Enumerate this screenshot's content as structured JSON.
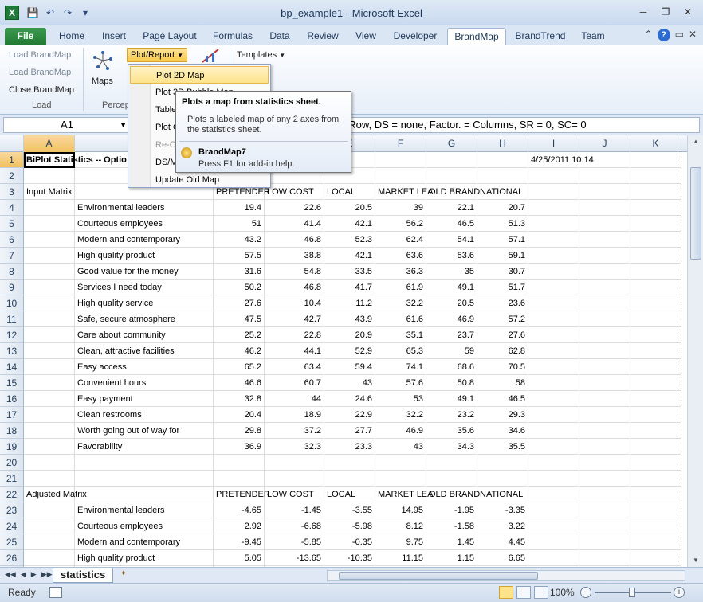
{
  "window": {
    "title": "bp_example1  -  Microsoft Excel",
    "app_icon": "X",
    "qat_icons": [
      "save-icon",
      "undo-icon",
      "redo-icon",
      "customize-qat-icon"
    ],
    "controls": [
      "minimize-icon",
      "restore-icon",
      "close-icon"
    ]
  },
  "ribbon_tabs": [
    {
      "label": "File"
    },
    {
      "label": "Home"
    },
    {
      "label": "Insert"
    },
    {
      "label": "Page Layout"
    },
    {
      "label": "Formulas"
    },
    {
      "label": "Data"
    },
    {
      "label": "Review"
    },
    {
      "label": "View"
    },
    {
      "label": "Developer"
    },
    {
      "label": "BrandMap"
    },
    {
      "label": "BrandTrend"
    },
    {
      "label": "Team"
    }
  ],
  "active_tab": "BrandMap",
  "ribbon": {
    "load_group": {
      "items": [
        "Load BrandMap",
        "Load BrandMap",
        "Close BrandMap"
      ],
      "label": "Load"
    },
    "maps_label": "Maps",
    "percep_label": "Percep",
    "plot_report_button": "Plot/Report",
    "templates_button": "Templates"
  },
  "plot_menu": {
    "items": [
      {
        "label": "Plot 2D Map",
        "state": "highlighted"
      },
      {
        "label": "Plot 3D Bubble Map",
        "state": "normal"
      },
      {
        "label": "Tables",
        "state": "normal"
      },
      {
        "label": "Plot Cluster",
        "state": "normal"
      },
      {
        "label": "Re-Color",
        "state": "disabled"
      },
      {
        "label": "DS/Mix",
        "state": "normal"
      },
      {
        "label": "Update Old Map",
        "state": "normal"
      }
    ]
  },
  "tooltip": {
    "title": "Plots a map from statistics sheet.",
    "description": "Plots a labeled map of any 2 axes from the statistics sheet.",
    "addin_name": "BrandMap7",
    "help": "Press F1 for add-in help."
  },
  "formula_bar": {
    "name_box": "A1",
    "content": "C = Row, DS = none, Factor. = Columns, SR = 0, SC= 0"
  },
  "columns": [
    "A",
    "B",
    "C",
    "D",
    "E",
    "F",
    "G",
    "H",
    "I",
    "J",
    "K"
  ],
  "selected_cell": "A1",
  "sheet": {
    "title_row": {
      "row": 1,
      "a": "BiPlot Statistics -- Optio",
      "d": "SC= 0",
      "i": "4/25/2011 10:14"
    },
    "input_label": "Input Matrix",
    "adjusted_label": "Adjusted Matrix",
    "headers": [
      "PRETENDER",
      "LOW COST",
      "LOCAL",
      "MARKET LEA",
      "OLD BRAND",
      "NATIONAL"
    ],
    "attributes": [
      "Environmental leaders",
      "Courteous employees",
      "Modern and contemporary",
      "High quality product",
      "Good value for the money",
      "Services I need today",
      "High quality service",
      "Safe, secure atmosphere",
      "Care about community",
      "Clean, attractive facilities",
      "Easy access",
      "Convenient hours",
      "Easy payment",
      "Clean restrooms",
      "Worth going out of way for",
      "Favorability"
    ],
    "input_values": [
      [
        "19.4",
        "22.6",
        "20.5",
        "39",
        "22.1",
        "20.7"
      ],
      [
        "51",
        "41.4",
        "42.1",
        "56.2",
        "46.5",
        "51.3"
      ],
      [
        "43.2",
        "46.8",
        "52.3",
        "62.4",
        "54.1",
        "57.1"
      ],
      [
        "57.5",
        "38.8",
        "42.1",
        "63.6",
        "53.6",
        "59.1"
      ],
      [
        "31.6",
        "54.8",
        "33.5",
        "36.3",
        "35",
        "30.7"
      ],
      [
        "50.2",
        "46.8",
        "41.7",
        "61.9",
        "49.1",
        "51.7"
      ],
      [
        "27.6",
        "10.4",
        "11.2",
        "32.2",
        "20.5",
        "23.6"
      ],
      [
        "47.5",
        "42.7",
        "43.9",
        "61.6",
        "46.9",
        "57.2"
      ],
      [
        "25.2",
        "22.8",
        "20.9",
        "35.1",
        "23.7",
        "27.6"
      ],
      [
        "46.2",
        "44.1",
        "52.9",
        "65.3",
        "59",
        "62.8"
      ],
      [
        "65.2",
        "63.4",
        "59.4",
        "74.1",
        "68.6",
        "70.5"
      ],
      [
        "46.6",
        "60.7",
        "43",
        "57.6",
        "50.8",
        "58"
      ],
      [
        "32.8",
        "44",
        "24.6",
        "53",
        "49.1",
        "46.5"
      ],
      [
        "20.4",
        "18.9",
        "22.9",
        "32.2",
        "23.2",
        "29.3"
      ],
      [
        "29.8",
        "37.2",
        "27.7",
        "46.9",
        "35.6",
        "34.6"
      ],
      [
        "36.9",
        "32.3",
        "23.3",
        "43",
        "34.3",
        "35.5"
      ]
    ],
    "adjusted_attributes": [
      "Environmental leaders",
      "Courteous employees",
      "Modern and contemporary",
      "High quality product"
    ],
    "adjusted_values": [
      [
        "-4.65",
        "-1.45",
        "-3.55",
        "14.95",
        "-1.95",
        "-3.35"
      ],
      [
        "2.92",
        "-6.68",
        "-5.98",
        "8.12",
        "-1.58",
        "3.22"
      ],
      [
        "-9.45",
        "-5.85",
        "-0.35",
        "9.75",
        "1.45",
        "4.45"
      ],
      [
        "5.05",
        "-13.65",
        "-10.35",
        "11.15",
        "1.15",
        "6.65"
      ]
    ]
  },
  "sheet_tabs": [
    {
      "label": "statistics"
    }
  ],
  "status_bar": {
    "ready": "Ready",
    "zoom": "100%",
    "zoom_percent": 100
  }
}
